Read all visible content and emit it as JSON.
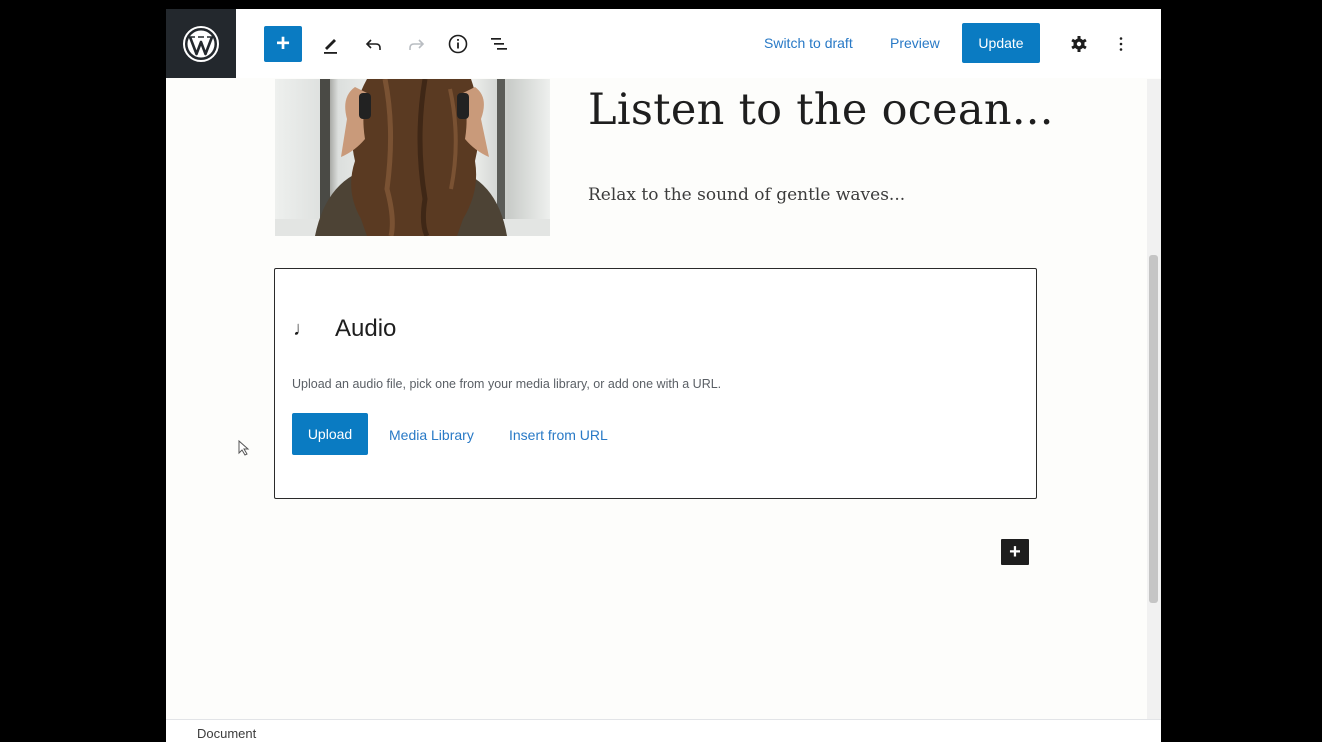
{
  "toolbar": {
    "add_block_symbol": "+",
    "switch_to_draft_label": "Switch to draft",
    "preview_label": "Preview",
    "update_label": "Update"
  },
  "content": {
    "heading": "Listen to the ocean...",
    "subheading": "Relax to the sound of gentle waves..."
  },
  "audio_block": {
    "icon_glyph": "♩",
    "title": "Audio",
    "help_text": "Upload an audio file, pick one from your media library, or add one with a URL.",
    "upload_label": "Upload",
    "media_library_label": "Media Library",
    "insert_from_url_label": "Insert from URL"
  },
  "add_block_symbol": "+",
  "footer": {
    "breadcrumb": "Document"
  },
  "colors": {
    "accent": "#0a7bc2",
    "link": "#2879c6",
    "logo_bg": "#23282d"
  }
}
